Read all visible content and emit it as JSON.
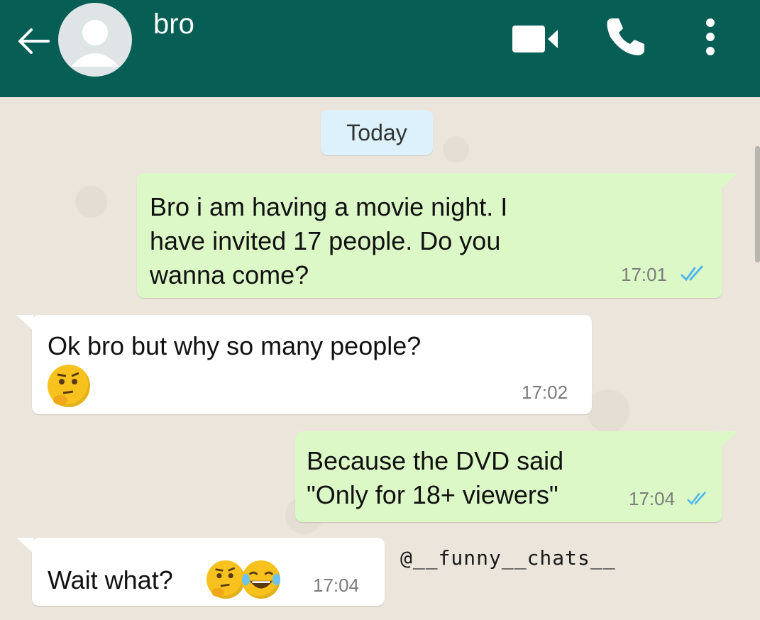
{
  "header": {
    "contact_name": "bro",
    "back_icon": "arrow-left-icon",
    "avatar_icon": "person-avatar-icon",
    "video_icon": "video-call-icon",
    "call_icon": "phone-icon",
    "menu_icon": "more-vertical-icon",
    "color": "#075e54"
  },
  "chat": {
    "date_label": "Today",
    "messages": [
      {
        "direction": "outgoing",
        "text": "Bro i am having a movie night. I\nhave invited 17 people. Do you\nwanna come?",
        "time": "17:01",
        "status_icon": "double-check-icon"
      },
      {
        "direction": "incoming",
        "text": "Ok bro but why so many people?",
        "emojis": [
          "thinking-face-icon"
        ],
        "time": "17:02"
      },
      {
        "direction": "outgoing",
        "text": "Because the DVD said\n\"Only for 18+ viewers\"",
        "time": "17:04",
        "status_icon": "double-check-icon"
      },
      {
        "direction": "incoming",
        "text": "Wait what?",
        "emojis": [
          "thinking-face-icon",
          "tears-of-joy-icon"
        ],
        "time": "17:04"
      }
    ]
  },
  "watermark": "@__funny__chats__",
  "colors": {
    "outgoing_bubble": "#dcf8c6",
    "incoming_bubble": "#ffffff",
    "date_chip": "#dcf1fb",
    "tick_color": "#4fb6ec"
  }
}
